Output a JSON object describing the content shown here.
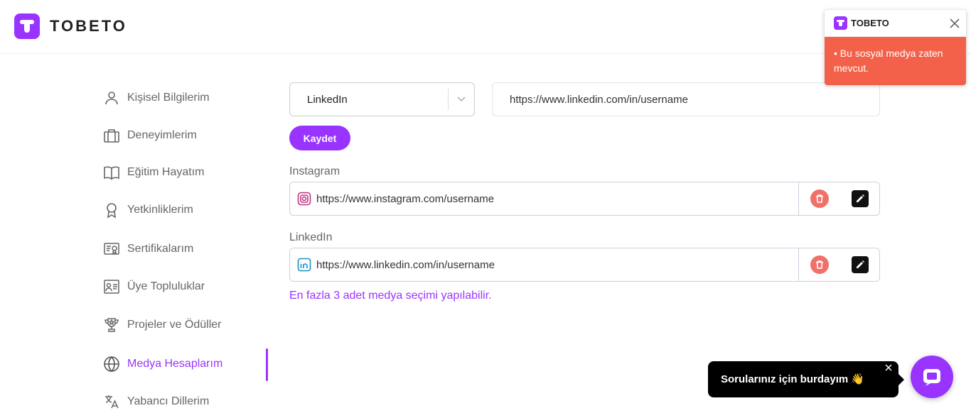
{
  "header": {
    "brand": "TOBETO"
  },
  "sidebar": {
    "items": [
      {
        "label": "Kişisel Bilgilerim",
        "icon": "user-icon"
      },
      {
        "label": "Deneyimlerim",
        "icon": "briefcase-icon"
      },
      {
        "label": "Eğitim Hayatım",
        "icon": "book-icon"
      },
      {
        "label": "Yetkinliklerim",
        "icon": "badge-icon"
      },
      {
        "label": "Sertifikalarım",
        "icon": "certificate-icon"
      },
      {
        "label": "Üye Topluluklar",
        "icon": "id-card-icon"
      },
      {
        "label": "Projeler ve Ödüller",
        "icon": "trophy-icon"
      },
      {
        "label": "Medya Hesaplarım",
        "icon": "globe-icon",
        "active": true
      },
      {
        "label": "Yabancı Dillerim",
        "icon": "translate-icon"
      }
    ]
  },
  "form": {
    "platform_selected": "LinkedIn",
    "url_value": "https://www.linkedin.com/in/username",
    "save_label": "Kaydet"
  },
  "media_accounts": [
    {
      "label": "Instagram",
      "url": "https://www.instagram.com/username",
      "icon": "instagram-icon"
    },
    {
      "label": "LinkedIn",
      "url": "https://www.linkedin.com/in/username",
      "icon": "linkedin-icon"
    }
  ],
  "hint": "En fazla 3 adet medya seçimi yapılabilir.",
  "toast": {
    "title": "TOBETO",
    "message": "• Bu sosyal medya zaten mevcut."
  },
  "chat": {
    "message": "Sorularınız için burdayım 👋"
  },
  "colors": {
    "accent": "#9933ff",
    "error": "#f4614a",
    "delete": "#f0706a"
  }
}
